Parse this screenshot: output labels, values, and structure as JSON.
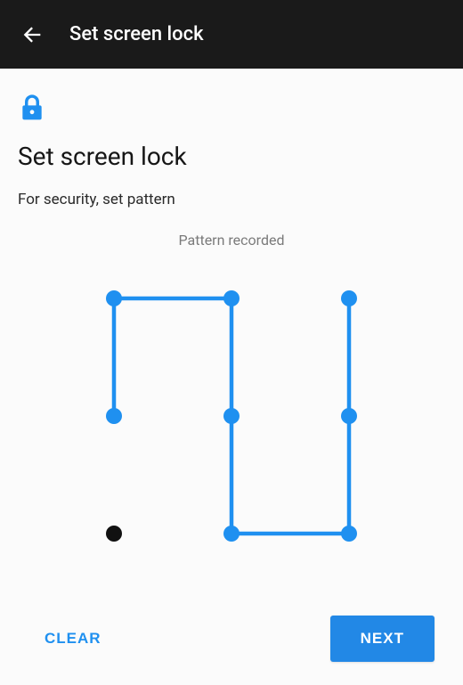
{
  "header": {
    "title": "Set screen lock"
  },
  "page": {
    "title": "Set screen lock",
    "subtitle": "For security, set pattern",
    "status": "Pattern recorded"
  },
  "pattern": {
    "grid_size": 3,
    "dots": {
      "0": {
        "row": 0,
        "col": 0,
        "active": true
      },
      "1": {
        "row": 0,
        "col": 1,
        "active": true
      },
      "2": {
        "row": 0,
        "col": 2,
        "active": true
      },
      "3": {
        "row": 1,
        "col": 0,
        "active": true
      },
      "4": {
        "row": 1,
        "col": 1,
        "active": true
      },
      "5": {
        "row": 1,
        "col": 2,
        "active": true
      },
      "6": {
        "row": 2,
        "col": 0,
        "active": false
      },
      "7": {
        "row": 2,
        "col": 1,
        "active": true
      },
      "8": {
        "row": 2,
        "col": 2,
        "active": true
      }
    },
    "path": [
      3,
      0,
      1,
      4,
      7,
      8,
      5,
      2
    ]
  },
  "footer": {
    "clear_label": "CLEAR",
    "next_label": "NEXT"
  },
  "colors": {
    "accent": "#1f90f0",
    "primary_button": "#2288e6",
    "header_bg": "#1a1a1a"
  }
}
